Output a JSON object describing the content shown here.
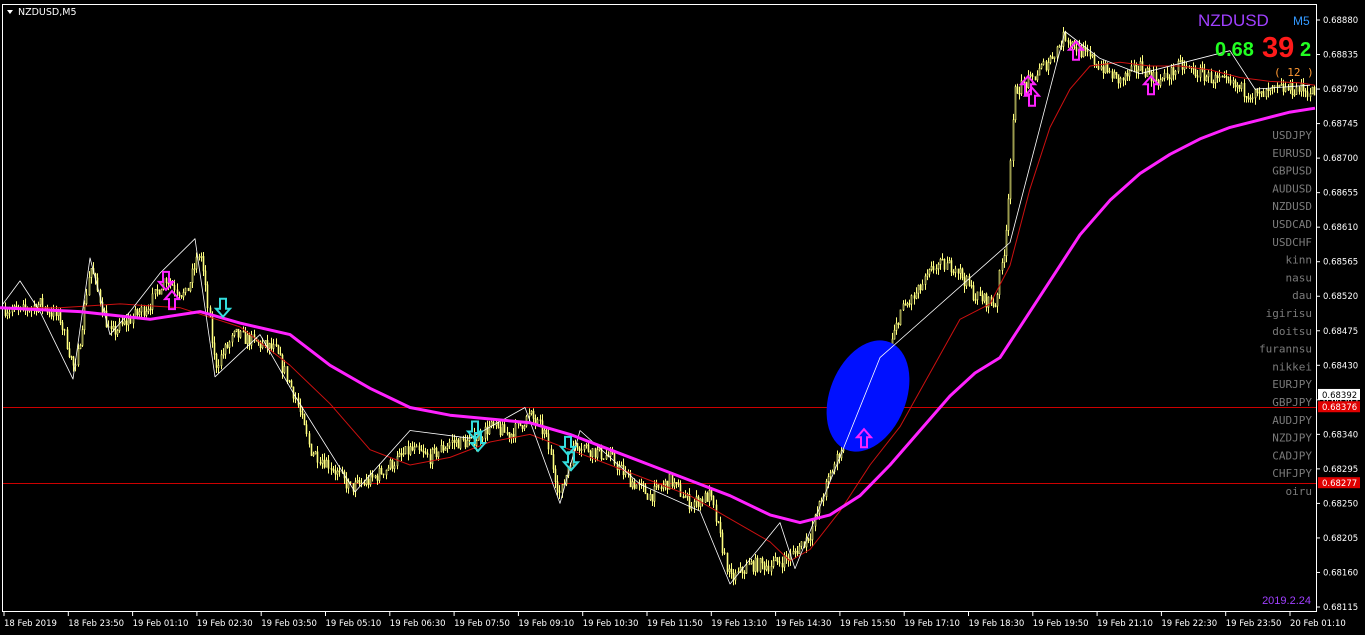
{
  "window": {
    "title": "NZDUSD,M5"
  },
  "colors": {
    "background": "#000000",
    "frame": "#ffffff",
    "candles": "#ffff80",
    "zigzag": "#ffffff",
    "ma_fast": "#cc1010",
    "ma_slow": "#ff22ff",
    "hline": "#cc0000",
    "arrow_up": "#ff22ff",
    "arrow_down": "#33dddd",
    "ellipse": "#0010ff",
    "symbol_text": "#7a7a7a",
    "date_stamp": "#a040ff"
  },
  "overlay": {
    "symbol": "NZDUSD",
    "timeframe": "M5",
    "price_main": "0.68",
    "price_big": "39",
    "price_last": "2",
    "spread": "( 12 )",
    "date_stamp": "2019.2.24"
  },
  "symbol_list": [
    "USDJPY",
    "EURUSD",
    "GBPUSD",
    "AUDUSD",
    "NZDUSD",
    "USDCAD",
    "USDCHF",
    "kinn",
    "nasu",
    "dau",
    "igirisu",
    "doitsu",
    "furannsu",
    "nikkei",
    "EURJPY",
    "GBPJPY",
    "AUDJPY",
    "NZDJPY",
    "CADJPY",
    "CHFJPY",
    "oiru"
  ],
  "price_tags": [
    {
      "text": "0.68392",
      "style": "current"
    },
    {
      "text": "0.68376",
      "style": "line"
    },
    {
      "text": "0.68277",
      "style": "line"
    }
  ],
  "chart_data": {
    "type": "candlestick",
    "y_axis": {
      "ticks": [
        "0.68880",
        "0.68835",
        "0.68790",
        "0.68745",
        "0.68700",
        "0.68655",
        "0.68610",
        "0.68565",
        "0.68520",
        "0.68475",
        "0.68430",
        "0.68385",
        "0.68340",
        "0.68295",
        "0.68250",
        "0.68205",
        "0.68160",
        "0.68115"
      ],
      "ylim": [
        0.68105,
        0.68895
      ]
    },
    "x_axis": {
      "labels": [
        "18 Feb 2019",
        "18 Feb 23:50",
        "19 Feb 01:10",
        "19 Feb 02:30",
        "19 Feb 03:50",
        "19 Feb 05:10",
        "19 Feb 06:30",
        "19 Feb 07:50",
        "19 Feb 09:10",
        "19 Feb 10:30",
        "19 Feb 11:50",
        "19 Feb 13:10",
        "19 Feb 14:30",
        "19 Feb 15:50",
        "19 Feb 17:10",
        "19 Feb 18:30",
        "19 Feb 19:50",
        "19 Feb 21:10",
        "19 Feb 22:30",
        "19 Feb 23:50",
        "20 Feb 01:10"
      ]
    },
    "price_path": [
      [
        0,
        0.68505
      ],
      [
        20,
        0.685
      ],
      [
        40,
        0.6851
      ],
      [
        60,
        0.6849
      ],
      [
        75,
        0.6842
      ],
      [
        90,
        0.6856
      ],
      [
        110,
        0.6847
      ],
      [
        130,
        0.6849
      ],
      [
        150,
        0.6851
      ],
      [
        165,
        0.68545
      ],
      [
        185,
        0.6852
      ],
      [
        200,
        0.6858
      ],
      [
        215,
        0.6843
      ],
      [
        235,
        0.6847
      ],
      [
        255,
        0.6846
      ],
      [
        275,
        0.6845
      ],
      [
        295,
        0.6839
      ],
      [
        310,
        0.6832
      ],
      [
        330,
        0.683
      ],
      [
        350,
        0.6827
      ],
      [
        370,
        0.6828
      ],
      [
        390,
        0.683
      ],
      [
        410,
        0.6832
      ],
      [
        430,
        0.6831
      ],
      [
        450,
        0.6833
      ],
      [
        470,
        0.6833
      ],
      [
        490,
        0.6835
      ],
      [
        510,
        0.6834
      ],
      [
        530,
        0.68365
      ],
      [
        545,
        0.6834
      ],
      [
        560,
        0.6826
      ],
      [
        575,
        0.6833
      ],
      [
        590,
        0.6832
      ],
      [
        610,
        0.6831
      ],
      [
        630,
        0.6828
      ],
      [
        650,
        0.6826
      ],
      [
        670,
        0.6828
      ],
      [
        690,
        0.6825
      ],
      [
        710,
        0.6826
      ],
      [
        730,
        0.6815
      ],
      [
        750,
        0.6817
      ],
      [
        770,
        0.6817
      ],
      [
        790,
        0.6818
      ],
      [
        810,
        0.6821
      ],
      [
        825,
        0.6827
      ],
      [
        840,
        0.6832
      ],
      [
        855,
        0.6836
      ],
      [
        870,
        0.6837
      ],
      [
        885,
        0.6843
      ],
      [
        900,
        0.685
      ],
      [
        915,
        0.6852
      ],
      [
        935,
        0.6856
      ],
      [
        955,
        0.6856
      ],
      [
        975,
        0.6852
      ],
      [
        995,
        0.6851
      ],
      [
        1005,
        0.6859
      ],
      [
        1015,
        0.6879
      ],
      [
        1030,
        0.688
      ],
      [
        1050,
        0.6883
      ],
      [
        1065,
        0.6886
      ],
      [
        1080,
        0.6884
      ],
      [
        1100,
        0.6882
      ],
      [
        1120,
        0.688
      ],
      [
        1140,
        0.6882
      ],
      [
        1160,
        0.688
      ],
      [
        1180,
        0.6882
      ],
      [
        1200,
        0.6881
      ],
      [
        1220,
        0.688
      ],
      [
        1240,
        0.6879
      ],
      [
        1260,
        0.6878
      ],
      [
        1280,
        0.6879
      ],
      [
        1300,
        0.6879
      ],
      [
        1315,
        0.68785
      ]
    ],
    "zigzag": [
      [
        3,
        0.6851
      ],
      [
        20,
        0.6854
      ],
      [
        40,
        0.685
      ],
      [
        73,
        0.68412
      ],
      [
        90,
        0.6857
      ],
      [
        110,
        0.6847
      ],
      [
        130,
        0.685
      ],
      [
        160,
        0.6855
      ],
      [
        195,
        0.68595
      ],
      [
        215,
        0.68415
      ],
      [
        260,
        0.6847
      ],
      [
        295,
        0.6839
      ],
      [
        355,
        0.68265
      ],
      [
        410,
        0.68345
      ],
      [
        470,
        0.68335
      ],
      [
        525,
        0.68375
      ],
      [
        560,
        0.6825
      ],
      [
        580,
        0.68345
      ],
      [
        640,
        0.68275
      ],
      [
        700,
        0.6824
      ],
      [
        730,
        0.68145
      ],
      [
        780,
        0.68225
      ],
      [
        795,
        0.68165
      ],
      [
        880,
        0.6844
      ],
      [
        1010,
        0.6859
      ],
      [
        1065,
        0.68865
      ],
      [
        1100,
        0.6883
      ],
      [
        1140,
        0.6881
      ],
      [
        1230,
        0.6884
      ],
      [
        1255,
        0.6879
      ],
      [
        1310,
        0.68795
      ]
    ],
    "ma_fast": [
      [
        0,
        0.68505
      ],
      [
        60,
        0.68505
      ],
      [
        120,
        0.6851
      ],
      [
        180,
        0.68505
      ],
      [
        240,
        0.6848
      ],
      [
        290,
        0.6843
      ],
      [
        330,
        0.6838
      ],
      [
        370,
        0.6832
      ],
      [
        410,
        0.683
      ],
      [
        450,
        0.6831
      ],
      [
        490,
        0.6833
      ],
      [
        530,
        0.6834
      ],
      [
        570,
        0.6832
      ],
      [
        610,
        0.683
      ],
      [
        650,
        0.6828
      ],
      [
        690,
        0.6826
      ],
      [
        730,
        0.6823
      ],
      [
        770,
        0.682
      ],
      [
        790,
        0.68175
      ],
      [
        810,
        0.6819
      ],
      [
        840,
        0.6824
      ],
      [
        870,
        0.683
      ],
      [
        900,
        0.6835
      ],
      [
        930,
        0.6842
      ],
      [
        960,
        0.6849
      ],
      [
        990,
        0.6851
      ],
      [
        1010,
        0.6856
      ],
      [
        1030,
        0.6866
      ],
      [
        1050,
        0.6874
      ],
      [
        1070,
        0.6879
      ],
      [
        1090,
        0.6882
      ],
      [
        1120,
        0.68825
      ],
      [
        1150,
        0.6882
      ],
      [
        1180,
        0.6882
      ],
      [
        1210,
        0.68815
      ],
      [
        1240,
        0.68805
      ],
      [
        1270,
        0.688
      ],
      [
        1300,
        0.68798
      ],
      [
        1315,
        0.68795
      ]
    ],
    "ma_slow": [
      [
        0,
        0.68505
      ],
      [
        80,
        0.685
      ],
      [
        150,
        0.6849
      ],
      [
        200,
        0.685
      ],
      [
        240,
        0.68485
      ],
      [
        290,
        0.6847
      ],
      [
        330,
        0.6843
      ],
      [
        370,
        0.684
      ],
      [
        410,
        0.68375
      ],
      [
        450,
        0.68365
      ],
      [
        490,
        0.6836
      ],
      [
        530,
        0.68355
      ],
      [
        570,
        0.6834
      ],
      [
        610,
        0.6832
      ],
      [
        650,
        0.683
      ],
      [
        690,
        0.6828
      ],
      [
        730,
        0.6826
      ],
      [
        770,
        0.68235
      ],
      [
        800,
        0.68225
      ],
      [
        830,
        0.68235
      ],
      [
        860,
        0.6826
      ],
      [
        890,
        0.683
      ],
      [
        920,
        0.68345
      ],
      [
        950,
        0.6839
      ],
      [
        975,
        0.6842
      ],
      [
        1000,
        0.6844
      ],
      [
        1020,
        0.6848
      ],
      [
        1050,
        0.6854
      ],
      [
        1080,
        0.686
      ],
      [
        1110,
        0.68645
      ],
      [
        1140,
        0.6868
      ],
      [
        1170,
        0.68705
      ],
      [
        1200,
        0.68725
      ],
      [
        1230,
        0.6874
      ],
      [
        1260,
        0.6875
      ],
      [
        1290,
        0.6876
      ],
      [
        1315,
        0.68765
      ]
    ],
    "hlines": [
      0.68376,
      0.68277
    ],
    "arrows": [
      {
        "x": 166,
        "price": 0.6854,
        "dir": "down",
        "color": "up"
      },
      {
        "x": 172,
        "price": 0.68515,
        "dir": "up",
        "color": "up"
      },
      {
        "x": 223,
        "price": 0.68505,
        "dir": "down",
        "color": "down"
      },
      {
        "x": 475,
        "price": 0.68345,
        "dir": "down",
        "color": "down"
      },
      {
        "x": 478,
        "price": 0.6833,
        "dir": "down",
        "color": "down"
      },
      {
        "x": 568,
        "price": 0.68325,
        "dir": "down",
        "color": "down"
      },
      {
        "x": 571,
        "price": 0.68305,
        "dir": "down",
        "color": "down"
      },
      {
        "x": 864,
        "price": 0.68335,
        "dir": "up",
        "color": "up"
      },
      {
        "x": 1028,
        "price": 0.68795,
        "dir": "up",
        "color": "up"
      },
      {
        "x": 1032,
        "price": 0.6878,
        "dir": "up",
        "color": "up"
      },
      {
        "x": 1076,
        "price": 0.6884,
        "dir": "up",
        "color": "up"
      },
      {
        "x": 1151,
        "price": 0.68795,
        "dir": "up",
        "color": "up"
      }
    ],
    "ellipse": {
      "x": 868,
      "price": 0.6839
    }
  }
}
